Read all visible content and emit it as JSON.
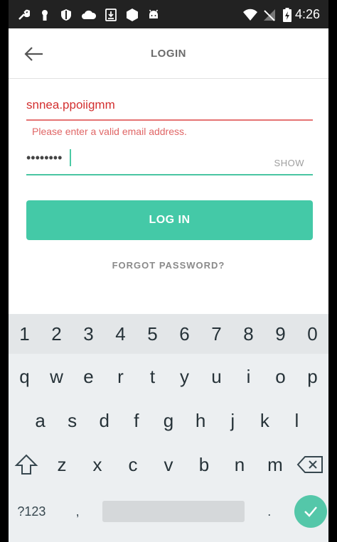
{
  "status_bar": {
    "time": "4:26",
    "icons": [
      "wrench-icon",
      "keyhole-icon",
      "shield-icon",
      "cloud-icon",
      "download-icon",
      "hexagon-icon",
      "android-icon",
      "wifi-icon",
      "no-signal-icon",
      "battery-charging-icon"
    ]
  },
  "header": {
    "title": "LOGIN",
    "back_icon": "arrow-left-icon"
  },
  "form": {
    "email_value": "snnea.ppoiigmm",
    "email_error": "Please enter a valid email address.",
    "password_masked": "••••••••",
    "show_label": "SHOW",
    "login_label": "LOG IN",
    "forgot_label": "FORGOT PASSWORD?"
  },
  "colors": {
    "accent": "#44c9a7",
    "error": "#d32f2f",
    "status_bar": "#222222"
  },
  "keyboard": {
    "numbers": [
      "1",
      "2",
      "3",
      "4",
      "5",
      "6",
      "7",
      "8",
      "9",
      "0"
    ],
    "row1": [
      "q",
      "w",
      "e",
      "r",
      "t",
      "y",
      "u",
      "i",
      "o",
      "p"
    ],
    "row2": [
      "a",
      "s",
      "d",
      "f",
      "g",
      "h",
      "j",
      "k",
      "l"
    ],
    "row3": [
      "z",
      "x",
      "c",
      "v",
      "b",
      "n",
      "m"
    ],
    "symbols_label": "?123",
    "comma": ",",
    "period": "."
  }
}
